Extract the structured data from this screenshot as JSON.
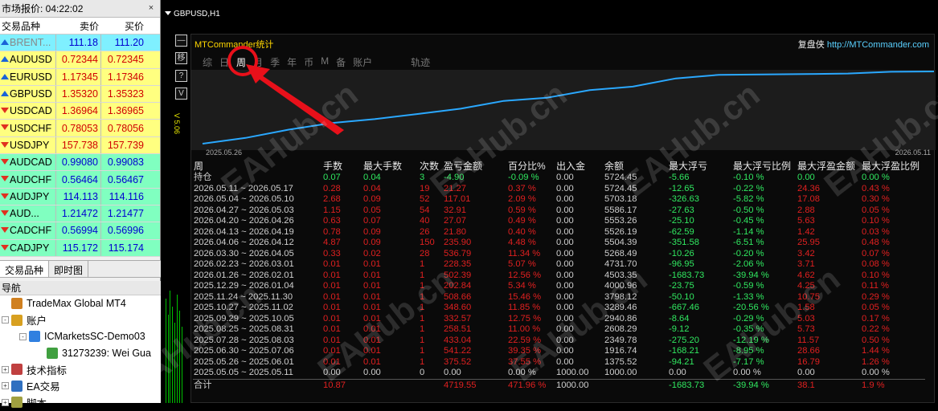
{
  "market_watch": {
    "title": "市场报价: 04:22:02",
    "headers": {
      "symbol": "交易品种",
      "bid": "卖价",
      "ask": "买价"
    },
    "rows": [
      {
        "symbol": "BRENT...",
        "bid": "111.18",
        "ask": "111.20",
        "dir": "up",
        "bg": "cyan"
      },
      {
        "symbol": "AUDUSD",
        "bid": "0.72344",
        "ask": "0.72345",
        "dir": "up",
        "bg": "yellow"
      },
      {
        "symbol": "EURUSD",
        "bid": "1.17345",
        "ask": "1.17346",
        "dir": "up",
        "bg": "yellow"
      },
      {
        "symbol": "GBPUSD",
        "bid": "1.35320",
        "ask": "1.35323",
        "dir": "up",
        "bg": "yellow"
      },
      {
        "symbol": "USDCAD",
        "bid": "1.36964",
        "ask": "1.36965",
        "dir": "down",
        "bg": "yellow"
      },
      {
        "symbol": "USDCHF",
        "bid": "0.78053",
        "ask": "0.78056",
        "dir": "down",
        "bg": "yellow"
      },
      {
        "symbol": "USDJPY",
        "bid": "157.738",
        "ask": "157.739",
        "dir": "down",
        "bg": "yellow"
      },
      {
        "symbol": "AUDCAD",
        "bid": "0.99080",
        "ask": "0.99083",
        "dir": "down",
        "bg": "green"
      },
      {
        "symbol": "AUDCHF",
        "bid": "0.56464",
        "ask": "0.56467",
        "dir": "down",
        "bg": "green"
      },
      {
        "symbol": "AUDJPY",
        "bid": "114.113",
        "ask": "114.116",
        "dir": "down",
        "bg": "green"
      },
      {
        "symbol": "AUD...",
        "bid": "1.21472",
        "ask": "1.21477",
        "dir": "down",
        "bg": "green"
      },
      {
        "symbol": "CADCHF",
        "bid": "0.56994",
        "ask": "0.56996",
        "dir": "down",
        "bg": "green"
      },
      {
        "symbol": "CADJPY",
        "bid": "115.172",
        "ask": "115.174",
        "dir": "down",
        "bg": "green"
      }
    ],
    "tabs": [
      "交易品种",
      "即时图"
    ]
  },
  "navigator": {
    "title": "导航",
    "items": [
      {
        "label": "TradeMax Global MT4",
        "indent": 0,
        "pm": "",
        "icon": "#d08020"
      },
      {
        "label": "账户",
        "indent": 0,
        "pm": "-",
        "icon": "#d8a020"
      },
      {
        "label": "ICMarketsSC-Demo03",
        "indent": 1,
        "pm": "-",
        "icon": "#3080e0"
      },
      {
        "label": "31273239: Wei Gua",
        "indent": 2,
        "pm": "",
        "icon": "#40a040"
      },
      {
        "label": "技术指标",
        "indent": 0,
        "pm": "+",
        "icon": "#c04040"
      },
      {
        "label": "EA交易",
        "indent": 0,
        "pm": "+",
        "icon": "#3070c0"
      },
      {
        "label": "脚本",
        "indent": 0,
        "pm": "+",
        "icon": "#a0a040"
      }
    ]
  },
  "chart": {
    "title": "GBPUSD,H1"
  },
  "panel": {
    "title": "MTCommander统计",
    "brand_cn": "复盘侠",
    "brand_url": "http://MTCommander.com",
    "side_buttons": [
      "—",
      "移",
      "?",
      "V"
    ],
    "tabs": [
      "综",
      "日",
      "周",
      "月",
      "季",
      "年",
      "币",
      "M",
      "备",
      "账户",
      "",
      "轨迹"
    ],
    "active_tab": "周",
    "version": "V 5.06",
    "date_start": "2025.05.26",
    "date_end": "2026.05.11",
    "table": {
      "headers": [
        "周",
        "手数",
        "最大手数",
        "次数",
        "盈亏金额",
        "百分比%",
        "出入金",
        "余额",
        "最大浮亏",
        "最大浮亏比例",
        "最大浮盈金额",
        "最大浮盈比例"
      ],
      "rows": [
        {
          "c": [
            "持仓",
            "0.07",
            "0.04",
            "3",
            "-4.90",
            "-0.09 %",
            "0.00",
            "5724.45",
            "-5.66",
            "-0.10 %",
            "0.00",
            "0.00 %"
          ],
          "s": "neg"
        },
        {
          "c": [
            "2026.05.11 ~ 2026.05.17",
            "0.28",
            "0.04",
            "19",
            "21.27",
            "0.37 %",
            "0.00",
            "5724.45",
            "-12.65",
            "-0.22 %",
            "24.36",
            "0.43 %"
          ],
          "s": "pos"
        },
        {
          "c": [
            "2026.05.04 ~ 2026.05.10",
            "2.68",
            "0.09",
            "52",
            "117.01",
            "2.09 %",
            "0.00",
            "5703.18",
            "-326.63",
            "-5.82 %",
            "17.08",
            "0.30 %"
          ],
          "s": "pos"
        },
        {
          "c": [
            "2026.04.27 ~ 2026.05.03",
            "1.15",
            "0.05",
            "54",
            "32.91",
            "0.59 %",
            "0.00",
            "5586.17",
            "-27.63",
            "-0.50 %",
            "2.88",
            "0.05 %"
          ],
          "s": "pos"
        },
        {
          "c": [
            "2026.04.20 ~ 2026.04.26",
            "0.63",
            "0.07",
            "40",
            "27.07",
            "0.49 %",
            "0.00",
            "5553.26",
            "-25.10",
            "-0.45 %",
            "5.63",
            "0.10 %"
          ],
          "s": "pos"
        },
        {
          "c": [
            "2026.04.13 ~ 2026.04.19",
            "0.78",
            "0.09",
            "26",
            "21.80",
            "0.40 %",
            "0.00",
            "5526.19",
            "-62.59",
            "-1.14 %",
            "1.42",
            "0.03 %"
          ],
          "s": "pos"
        },
        {
          "c": [
            "2026.04.06 ~ 2026.04.12",
            "4.87",
            "0.09",
            "150",
            "235.90",
            "4.48 %",
            "0.00",
            "5504.39",
            "-351.58",
            "-6.51 %",
            "25.95",
            "0.48 %"
          ],
          "s": "pos"
        },
        {
          "c": [
            "2026.03.30 ~ 2026.04.05",
            "0.33",
            "0.02",
            "28",
            "536.79",
            "11.34 %",
            "0.00",
            "5268.49",
            "-10.26",
            "-0.20 %",
            "3.42",
            "0.07 %"
          ],
          "s": "pos"
        },
        {
          "c": [
            "2026.02.23 ~ 2026.03.01",
            "0.01",
            "0.01",
            "1",
            "228.35",
            "5.07 %",
            "0.00",
            "4731.70",
            "-96.95",
            "-2.06 %",
            "3.71",
            "0.08 %"
          ],
          "s": "pos"
        },
        {
          "c": [
            "2026.01.26 ~ 2026.02.01",
            "0.01",
            "0.01",
            "1",
            "502.39",
            "12.56 %",
            "0.00",
            "4503.35",
            "-1683.73",
            "-39.94 %",
            "4.62",
            "0.10 %"
          ],
          "s": "pos"
        },
        {
          "c": [
            "2025.12.29 ~ 2026.01.04",
            "0.01",
            "0.01",
            "1",
            "202.84",
            "5.34 %",
            "0.00",
            "4000.96",
            "-23.75",
            "-0.59 %",
            "4.25",
            "0.11 %"
          ],
          "s": "pos"
        },
        {
          "c": [
            "2025.11.24 ~ 2025.11.30",
            "0.01",
            "0.01",
            "1",
            "508.66",
            "15.46 %",
            "0.00",
            "3798.12",
            "-50.10",
            "-1.33 %",
            "10.75",
            "0.29 %"
          ],
          "s": "pos"
        },
        {
          "c": [
            "2025.10.27 ~ 2025.11.02",
            "0.01",
            "0.01",
            "1",
            "348.60",
            "11.85 %",
            "0.00",
            "3289.46",
            "-667.46",
            "-20.56 %",
            "1.58",
            "0.05 %"
          ],
          "s": "pos"
        },
        {
          "c": [
            "2025.09.29 ~ 2025.10.05",
            "0.01",
            "0.01",
            "1",
            "332.57",
            "12.75 %",
            "0.00",
            "2940.86",
            "-8.64",
            "-0.29 %",
            "5.03",
            "0.17 %"
          ],
          "s": "pos"
        },
        {
          "c": [
            "2025.08.25 ~ 2025.08.31",
            "0.01",
            "0.01",
            "1",
            "258.51",
            "11.00 %",
            "0.00",
            "2608.29",
            "-9.12",
            "-0.35 %",
            "5.73",
            "0.22 %"
          ],
          "s": "pos"
        },
        {
          "c": [
            "2025.07.28 ~ 2025.08.03",
            "0.01",
            "0.01",
            "1",
            "433.04",
            "22.59 %",
            "0.00",
            "2349.78",
            "-275.20",
            "-12.19 %",
            "11.57",
            "0.50 %"
          ],
          "s": "pos"
        },
        {
          "c": [
            "2025.06.30 ~ 2025.07.06",
            "0.01",
            "0.01",
            "1",
            "541.22",
            "39.35 %",
            "0.00",
            "1916.74",
            "-168.21",
            "-8.95 %",
            "28.66",
            "1.44 %"
          ],
          "s": "pos"
        },
        {
          "c": [
            "2025.05.26 ~ 2025.06.01",
            "0.01",
            "0.01",
            "1",
            "375.52",
            "37.55 %",
            "0.00",
            "1375.52",
            "-94.21",
            "-7.17 %",
            "16.79",
            "1.26 %"
          ],
          "s": "pos"
        },
        {
          "c": [
            "2025.05.05 ~ 2025.05.11",
            "0.00",
            "0.00",
            "0",
            "0.00",
            "0.00 %",
            "1000.00",
            "1000.00",
            "0.00",
            "0.00 %",
            "0.00",
            "0.00 %"
          ],
          "s": "neu"
        }
      ],
      "total": {
        "c": [
          "合计",
          "10.87",
          "",
          "",
          "4719.55",
          "471.96 %",
          "1000.00",
          "",
          "-1683.73",
          "-39.94 %",
          "38.1",
          "1.9 %"
        ]
      }
    }
  },
  "watermark": "EAHub.cn"
}
